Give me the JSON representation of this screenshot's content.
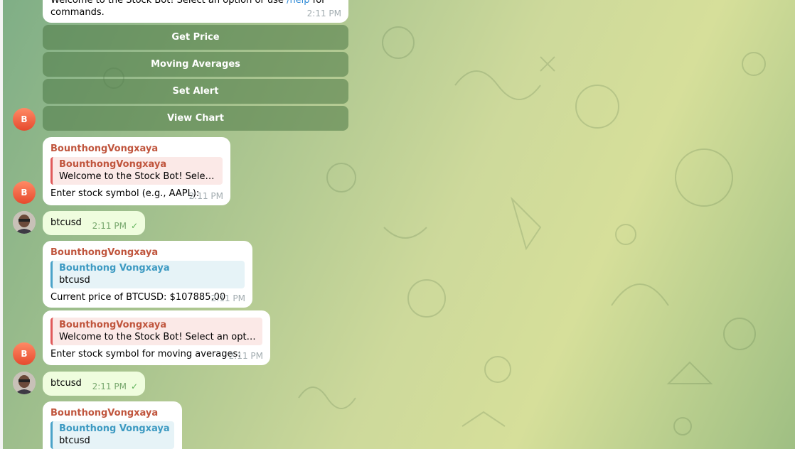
{
  "intro": {
    "text_line1": "Welcome to the Stock Bot! Select an option or use ",
    "help_link": "/help",
    "text_line1_end": " for",
    "text_line2": "commands.",
    "time": "2:11 PM"
  },
  "keyboard": {
    "buttons": [
      "Get Price",
      "Moving Averages",
      "Set Alert",
      "View Chart"
    ]
  },
  "bot": {
    "avatar_letter": "B",
    "name": "BounthongVongxaya"
  },
  "messages": [
    {
      "sender": "BounthongVongxaya",
      "quote_name": "BounthongVongxaya",
      "quote_text": "Welcome to the Stock Bot! Select an ...",
      "text": "Enter stock symbol (e.g., AAPL):",
      "time": "2:11 PM"
    },
    {
      "text": "btcusd",
      "time": "2:11 PM"
    },
    {
      "sender": "BounthongVongxaya",
      "quote_name": "Bounthong Vongxaya",
      "quote_text": "btcusd",
      "text": "Current price of BTCUSD: $107885.00",
      "time": "2:11 PM"
    },
    {
      "quote_name": "BounthongVongxaya",
      "quote_text": "Welcome to the Stock Bot! Select an option or...",
      "text": "Enter stock symbol for moving averages:",
      "time": "2:11 PM"
    },
    {
      "text": "btcusd",
      "time": "2:11 PM"
    },
    {
      "sender": "BounthongVongxaya",
      "quote_name": "Bounthong Vongxaya",
      "quote_text": "btcusd"
    }
  ],
  "colors": {
    "accent_sender": "#c0553d",
    "quote_blue": "#3d9ac2",
    "read_check": "#5fb35a"
  }
}
